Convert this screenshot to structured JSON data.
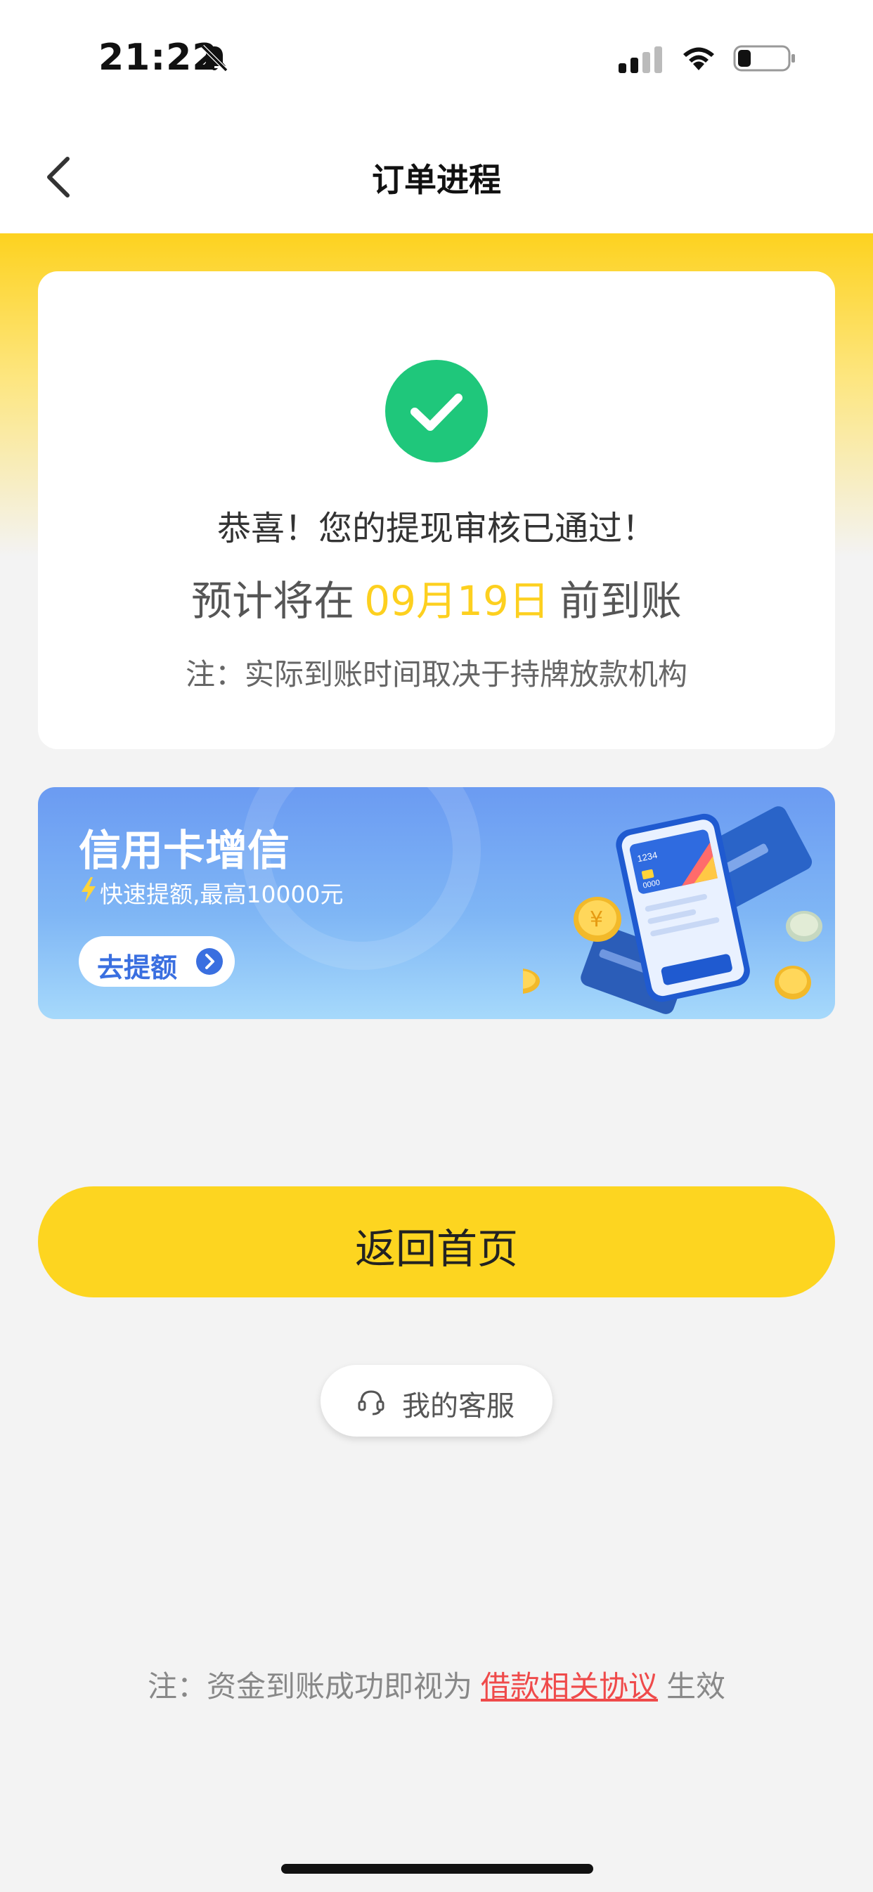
{
  "status_bar": {
    "time": "21:22"
  },
  "nav": {
    "title": "订单进程"
  },
  "success_card": {
    "title": "恭喜！您的提现审核已通过！",
    "arrival_prefix": "预计将在",
    "arrival_date": "09月19日",
    "arrival_suffix": "前到账",
    "note": "注：实际到账时间取决于持牌放款机构"
  },
  "banner": {
    "title": "信用卡增信",
    "subtitle": "快速提额,最高10000元",
    "button_label": "去提额",
    "card_number": "1234",
    "card_digits": "0000"
  },
  "actions": {
    "home_label": "返回首页",
    "service_label": "我的客服"
  },
  "footer": {
    "note_prefix": "注：资金到账成功即视为",
    "link_label": "借款相关协议",
    "note_suffix": "生效"
  },
  "colors": {
    "accent_yellow": "#fdd520",
    "success_green": "#1fc77b",
    "date_yellow": "#fdd01f",
    "link_red": "#ef4a4a",
    "banner_blue": "#6b9bf2"
  },
  "icons": [
    "bell-off-icon",
    "signal-icon",
    "wifi-icon",
    "battery-icon",
    "back-icon",
    "check-icon",
    "bolt-icon",
    "chevron-right-icon",
    "headset-icon"
  ]
}
